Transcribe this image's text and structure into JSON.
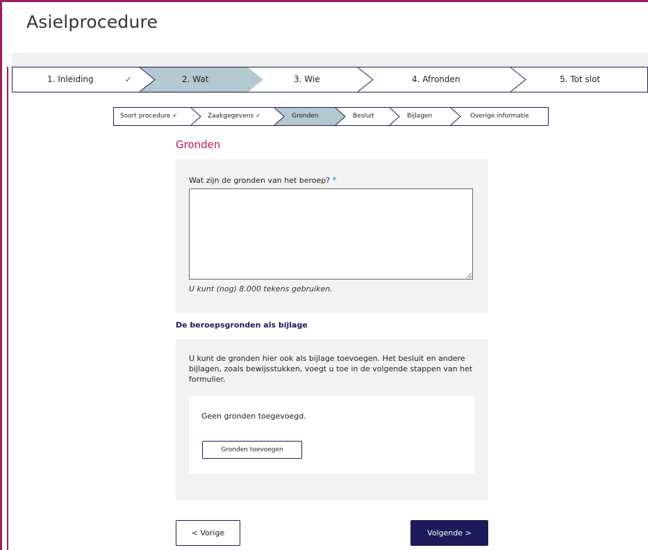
{
  "app": {
    "title": "Asielprocedure"
  },
  "steps": [
    {
      "label": "1. Inleiding",
      "check": "✓"
    },
    {
      "label": "2. Wat"
    },
    {
      "label": "3. Wie"
    },
    {
      "label": "4. Afronden"
    },
    {
      "label": "5. Tot slot"
    }
  ],
  "substeps": [
    {
      "label": "Soort procedure ✓"
    },
    {
      "label": "Zaakgegevens ✓"
    },
    {
      "label": "Gronden"
    },
    {
      "label": "Besluit"
    },
    {
      "label": "Bijlagen"
    },
    {
      "label": "Overige informatie"
    }
  ],
  "section": {
    "title": "Gronden"
  },
  "question": {
    "label": "Wat zijn de gronden van het beroep?",
    "required_mark": "*",
    "value": "",
    "hint": "U kunt (nog) 8.000 tekens gebruiken."
  },
  "attachment": {
    "heading": "De beroepsgronden als bijlage",
    "description": "U kunt de gronden hier ook als bijlage toevoegen. Het besluit en andere bijlagen, zoals bewijsstukken, voegt u toe in de volgende stappen van het formulier.",
    "empty_text": "Geen gronden toegevoegd.",
    "add_button": "Gronden toevoegen"
  },
  "nav": {
    "prev": "< Vorige",
    "next": "Volgende >"
  },
  "colors": {
    "brand": "#9c1c5c",
    "accent": "#b5195e",
    "navy": "#1b1b5a",
    "active_step": "#b3c8d0"
  }
}
